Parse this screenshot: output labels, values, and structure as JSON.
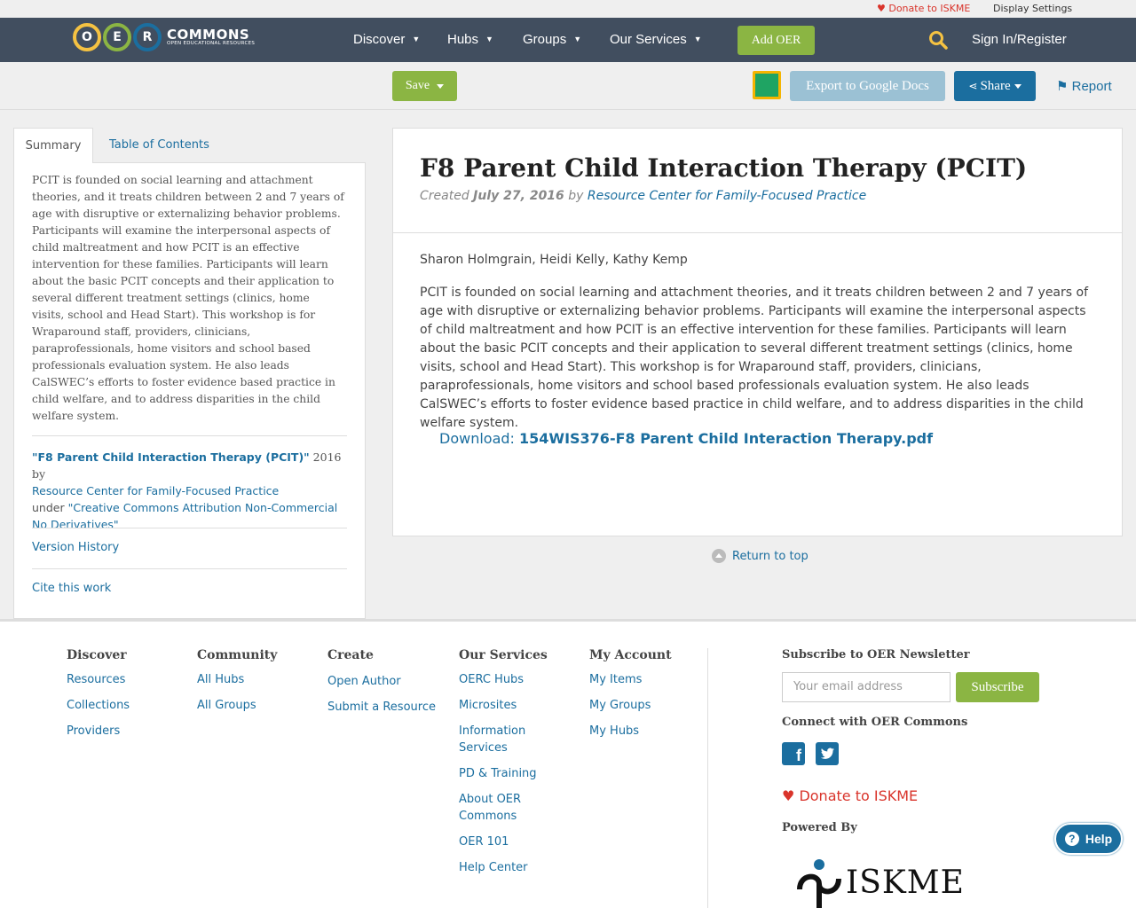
{
  "utility": {
    "donate": "♥ Donate to ISKME",
    "display_settings": "Display Settings"
  },
  "logo": {
    "letters": [
      "O",
      "E",
      "R"
    ],
    "name": "COMMONS",
    "tagline": "OPEN EDUCATIONAL RESOURCES",
    "colors": [
      "#f5c242",
      "#8bb543",
      "#1b6e9f"
    ]
  },
  "nav": {
    "items": [
      "Discover",
      "Hubs",
      "Groups",
      "Our Services"
    ],
    "add_oer": "Add OER",
    "sign_in": "Sign In/Register"
  },
  "toolbar": {
    "save": "Save",
    "export": "Export to Google Docs",
    "share": "Share",
    "report": "Report"
  },
  "sidebar": {
    "tabs": [
      "Summary",
      "Table of Contents"
    ],
    "summary": "PCIT is founded on social learning and attachment theories, and it treats children between 2 and 7 years of age with disruptive or externalizing behavior problems. Participants will examine the interpersonal aspects of child maltreatment and how PCIT is an effective intervention for these families. Participants will learn about the basic PCIT concepts and their application to several different treatment settings (clinics, home visits, school and Head Start). This workshop is for Wraparound staff, providers, clinicians, paraprofessionals, home visitors and school based professionals evaluation system. He also leads CalSWEC’s efforts to foster evidence based practice in child welfare, and to address disparities in the child welfare system.",
    "license": {
      "work_title": "\"F8 Parent Child Interaction Therapy (PCIT)\"",
      "year_by": " 2016 by",
      "author": "Resource Center for Family-Focused Practice",
      "under": "under ",
      "license_name": "\"Creative Commons Attribution Non-Commercial No Derivatives\""
    },
    "version_history": "Version History",
    "cite": "Cite this work"
  },
  "content": {
    "title": "F8 Parent Child Interaction Therapy (PCIT)",
    "created_label": "Created ",
    "created_date": "July 27, 2016",
    "by_label": " by ",
    "creator": "Resource Center for Family-Focused Practice",
    "authors": "Sharon Holmgrain, Heidi Kelly, Kathy Kemp",
    "body": "PCIT is founded on social learning and attachment theories, and it treats children between 2 and 7 years of age with disruptive or externalizing behavior problems. Participants will examine the interpersonal aspects of child maltreatment and how PCIT is an effective intervention for these families. Participants will learn about the basic PCIT concepts and their application to several different treatment settings (clinics, home visits, school and Head Start). This workshop is for Wraparound staff, providers, clinicians, paraprofessionals, home visitors and school based professionals evaluation system. He also leads CalSWEC’s efforts to foster evidence based practice in child welfare, and to address disparities in the child welfare system.",
    "download_label": "Download: ",
    "download_file": "154WIS376-F8 Parent Child Interaction Therapy.pdf",
    "return_top": "Return to top"
  },
  "footer": {
    "discover": {
      "title": "Discover",
      "links": [
        "Resources",
        "Collections",
        "Providers"
      ]
    },
    "community": {
      "title": "Community",
      "links": [
        "All Hubs",
        "All Groups"
      ]
    },
    "create": {
      "title": "Create",
      "links": [
        "Open Author",
        "Submit a Resource"
      ]
    },
    "services": {
      "title": "Our Services",
      "links": [
        "OERC Hubs",
        "Microsites",
        "Information Services",
        "PD & Training",
        "About OER Commons",
        "OER 101",
        "Help Center"
      ]
    },
    "account": {
      "title": "My Account",
      "links": [
        "My Items",
        "My Groups",
        "My Hubs"
      ]
    },
    "newsletter_title": "Subscribe to OER Newsletter",
    "email_placeholder": "Your email address",
    "subscribe": "Subscribe",
    "connect_title": "Connect with OER Commons",
    "donate": "Donate to ISKME",
    "powered_by": "Powered By",
    "iskme": "ISKME"
  },
  "help": "Help"
}
